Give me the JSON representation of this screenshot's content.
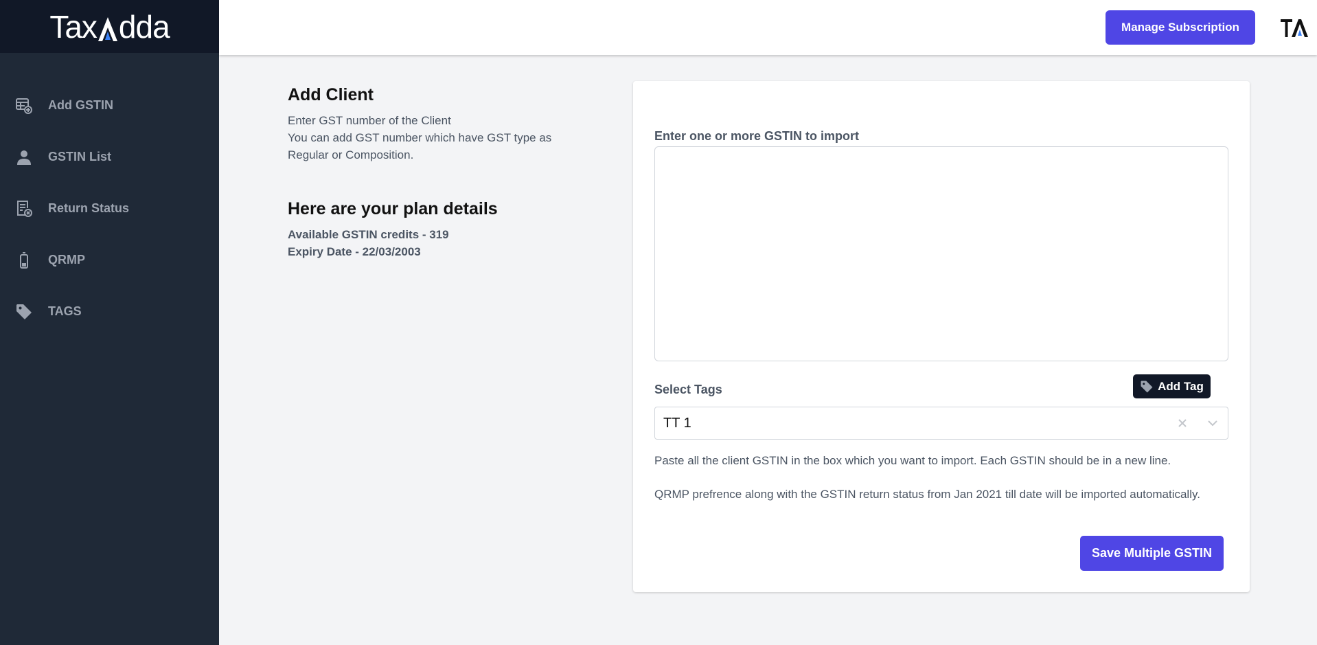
{
  "brand": {
    "logo_pre": "Tax",
    "logo_post": "dda"
  },
  "sidebar": {
    "items": [
      {
        "label": "Add GSTIN",
        "icon": "add-table-icon"
      },
      {
        "label": "GSTIN List",
        "icon": "user-icon"
      },
      {
        "label": "Return Status",
        "icon": "document-cancel-icon"
      },
      {
        "label": "QRMP",
        "icon": "battery-icon"
      },
      {
        "label": "TAGS",
        "icon": "tag-icon"
      }
    ]
  },
  "header": {
    "manage_label": "Manage Subscription",
    "mark_icon": "ta-logo-icon"
  },
  "info": {
    "title": "Add Client",
    "line1": "Enter GST number of the Client",
    "line2": "You can add GST number which have GST type as Regular or Composition.",
    "plan_title": "Here are your plan details",
    "credits": "Available GSTIN credits - 319",
    "expiry": "Expiry Date - 22/03/2003"
  },
  "form": {
    "gstin_label": "Enter one or more GSTIN to import",
    "gstin_value": "",
    "tags_label": "Select Tags",
    "add_tag_label": "Add Tag",
    "selected_tag": "TT 1",
    "help1": "Paste all the client GSTIN in the box which you want to import. Each GSTIN should be in a new line.",
    "help2": "QRMP prefrence along with the GSTIN return status from Jan 2021 till date will be imported automatically.",
    "save_label": "Save Multiple GSTIN"
  },
  "colors": {
    "accent": "#4f46e5",
    "sidebar": "#1f2937",
    "logo_bar": "#111827",
    "logo_accent": "#3b82f6"
  }
}
